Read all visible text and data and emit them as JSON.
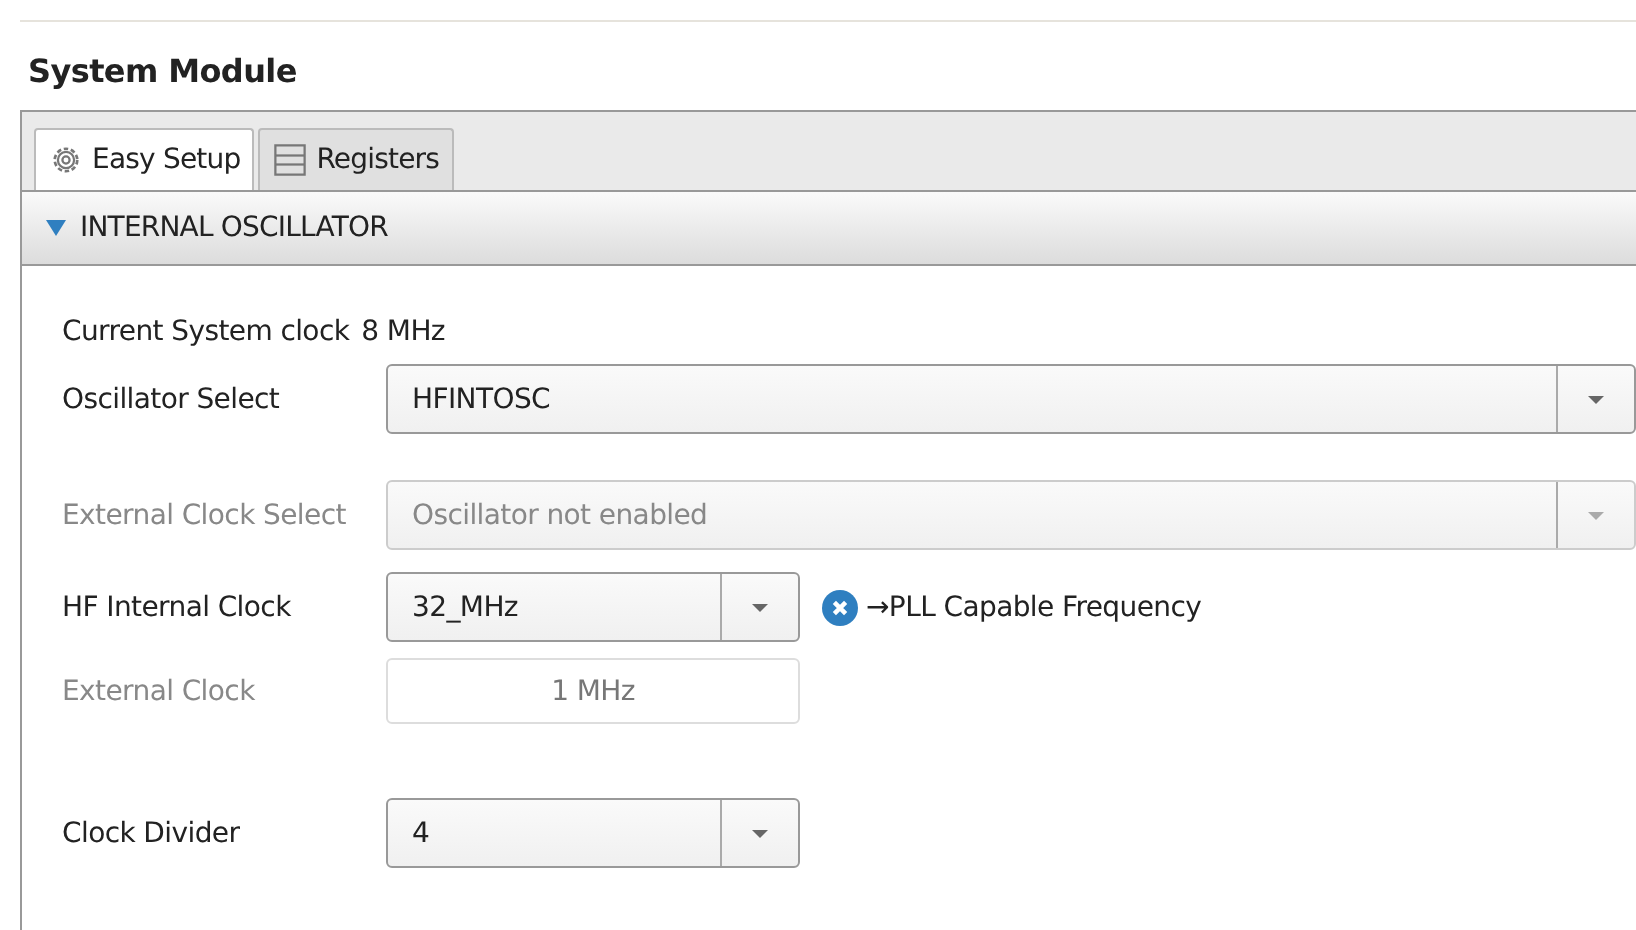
{
  "title": "System Module",
  "tabs": [
    {
      "label": "Easy Setup",
      "kind": "gear",
      "selected": true
    },
    {
      "label": "Registers",
      "kind": "list",
      "selected": false
    }
  ],
  "section": {
    "title": "INTERNAL OSCILLATOR",
    "expanded": true
  },
  "rows": [
    {
      "kind": "info",
      "label": "Current System clock",
      "value": "8 MHz",
      "disabled": false
    },
    {
      "kind": "wide-combo",
      "label": "Oscillator Select",
      "value": "HFINTOSC",
      "disabled": false
    },
    {
      "kind": "wide-combo",
      "label": "External Clock Select",
      "value": "Oscillator not enabled",
      "disabled": true
    },
    {
      "kind": "combo",
      "label": "HF Internal Clock",
      "value": "32_MHz",
      "disabled": false,
      "note": "→PLL Capable Frequency"
    },
    {
      "kind": "field",
      "label": "External Clock",
      "value": "1 MHz",
      "disabled": true
    },
    {
      "kind": "combo",
      "label": "Clock Divider",
      "value": "4",
      "disabled": false
    }
  ]
}
